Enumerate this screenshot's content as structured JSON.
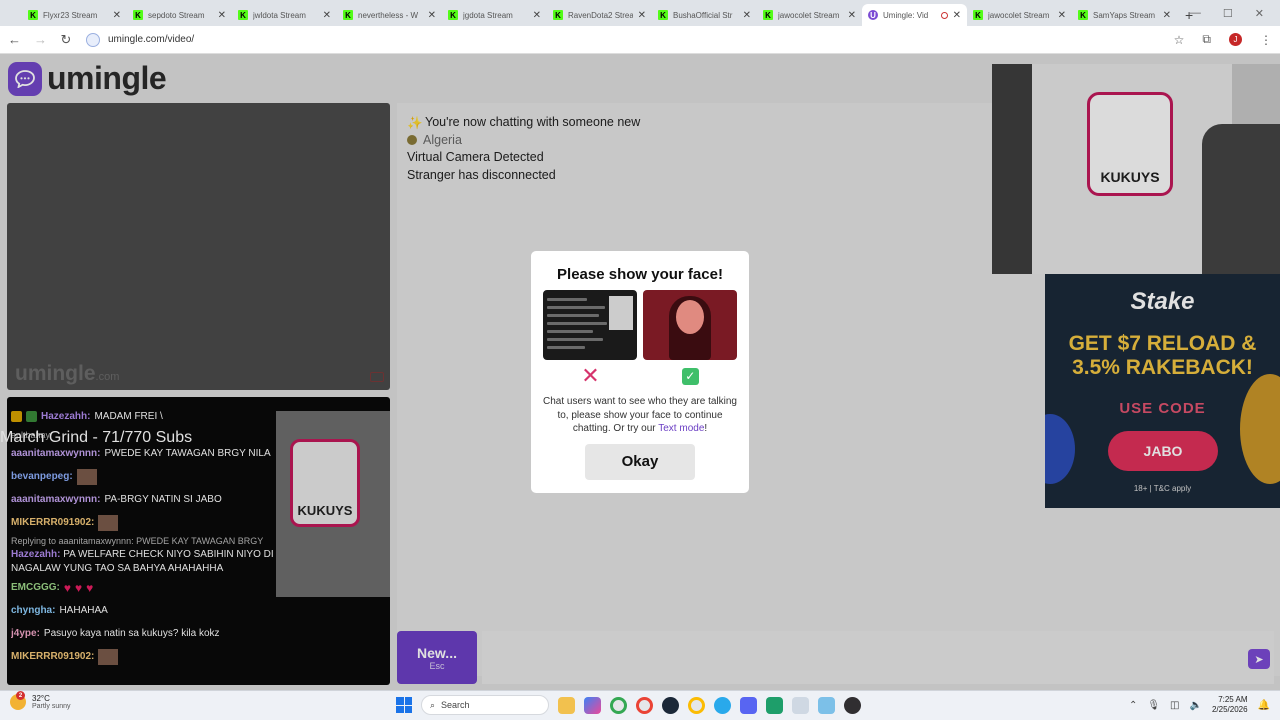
{
  "browser": {
    "tabs": [
      {
        "label": "Flyxr23 Stream",
        "favicon": "K",
        "active": false
      },
      {
        "label": "sepdoto Stream",
        "favicon": "K",
        "active": false
      },
      {
        "label": "jwldota Stream",
        "favicon": "K",
        "active": false
      },
      {
        "label": "nevertheless - W",
        "favicon": "K",
        "active": false
      },
      {
        "label": "jgdota Stream",
        "favicon": "K",
        "active": false
      },
      {
        "label": "RavenDota2 Strea",
        "favicon": "K",
        "active": false
      },
      {
        "label": "BushaOfficial Str",
        "favicon": "K",
        "active": false
      },
      {
        "label": "jawocolet Stream",
        "favicon": "K",
        "active": false
      },
      {
        "label": "Umingle: Vid",
        "favicon": "U",
        "active": true
      },
      {
        "label": "jawocolet Stream",
        "favicon": "K",
        "active": false
      },
      {
        "label": "SamYaps Stream",
        "favicon": "K",
        "active": false
      }
    ],
    "url": "umingle.com/video/",
    "profile_initial": "J"
  },
  "site": {
    "logo_text": "umingle",
    "watermark": "umingle",
    "watermark_suffix": ".com"
  },
  "chat": {
    "messages": [
      {
        "icon": "sparkle-icon",
        "text": "You're now chatting with someone new",
        "style": "normal"
      },
      {
        "icon": "globe-icon",
        "text": "Algeria",
        "style": "grey"
      },
      {
        "icon": "",
        "text": "Virtual Camera Detected",
        "style": "normal"
      },
      {
        "icon": "",
        "text": "Stranger has disconnected",
        "style": "normal"
      }
    ],
    "new_button": {
      "label": "New...",
      "hint": "Esc"
    }
  },
  "stream_overlay": {
    "title": "March Grind - 71/770 Subs",
    "chat_lines": [
      {
        "user": "Hazezahh:",
        "text": "MADAM FREI \\",
        "color": "#b28cf0"
      },
      {
        "user": "",
        "text": "apltbahay",
        "color": "#fff"
      },
      {
        "user": "aaanitamaxwynnn:",
        "text": "PWEDE KAY TAWAGAN BRGY NILA",
        "color": "#c7a6f3"
      },
      {
        "user": "bevanpepeg:",
        "text": "",
        "color": "#8fb1ff"
      },
      {
        "user": "aaanitamaxwynnn:",
        "text": "PA-BRGY NATIN SI JABO",
        "color": "#c7a6f3"
      },
      {
        "user": "MIKERRR091902:",
        "text": "",
        "color": "#f5c97a"
      },
      {
        "user": "",
        "text": "Replying to aaanitamaxwynnn: PWEDE KAY TAWAGAN BRGY",
        "color": "#bbb"
      },
      {
        "user": "Hazezahh:",
        "text": "PA WELFARE CHECK NIYO SABIHIN NIYO DI NAGALAW YUNG TAO SA BAHYA AHAHAHHA",
        "color": "#b28cf0"
      },
      {
        "user": "EMCGGG:",
        "text": "",
        "color": "#9fd88a"
      },
      {
        "user": "chyngha:",
        "text": "HAHAHAA",
        "color": "#8fd0ff"
      },
      {
        "user": "j4ype:",
        "text": "Pasuyo kaya natin sa kukuys? kila kokz",
        "color": "#f3a6c8"
      },
      {
        "user": "MIKERRR091902:",
        "text": "",
        "color": "#f5c97a"
      }
    ],
    "decal_text": "KUKUYS"
  },
  "modal": {
    "title": "Please show your face!",
    "body_text": "Chat users want to see who they are talking to, please show your face to continue chatting. Or try our",
    "link_text": "Text mode",
    "after_link": "!",
    "okay_label": "Okay",
    "bad_mark": "✕",
    "good_mark": "✓"
  },
  "ad": {
    "brand": "Stake",
    "headline_1": "GET $7 RELOAD &",
    "headline_2": "3.5% RAKEBACK!",
    "use_code": "USE CODE",
    "code": "JABO",
    "terms": "18+ | T&C apply"
  },
  "webcam": {
    "poster_text": "KUKUYS"
  },
  "taskbar": {
    "temperature": "32°C",
    "weather": "Partly sunny",
    "weather_badge": "2",
    "search_placeholder": "Search",
    "time": "7:25 AM",
    "date": "2/25/2026"
  }
}
